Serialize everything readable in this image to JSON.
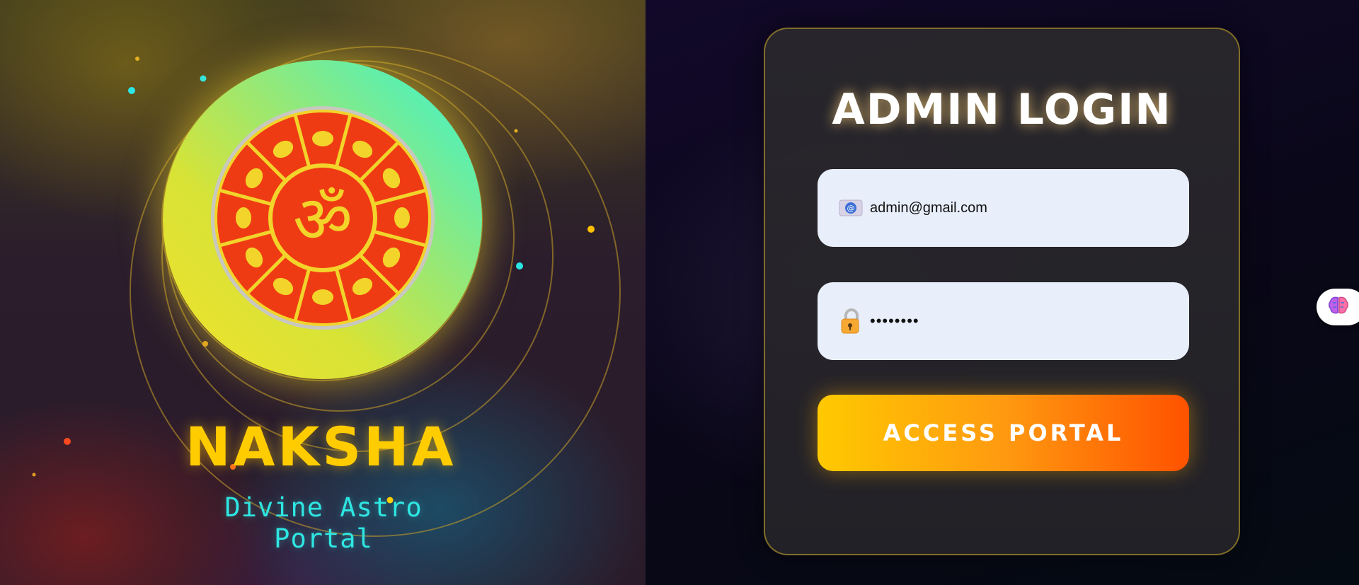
{
  "brand": {
    "name": "NAKSHA",
    "tagline": "Divine Astro Portal",
    "emblem_icon": "om-zodiac-wheel-icon"
  },
  "login": {
    "title": "ADMIN LOGIN",
    "email": {
      "value": "admin@gmail.com",
      "icon": "email-icon"
    },
    "password": {
      "value": "password",
      "icon": "lock-icon"
    },
    "submit_label": "ACCESS PORTAL"
  },
  "side_widget": {
    "icon": "brain-icon"
  },
  "colors": {
    "accent_gold": "#ffcc00",
    "accent_cyan": "#2ee6e2",
    "button_start": "#ffc900",
    "button_end": "#ff5200",
    "wheel_red": "#ef3b14"
  }
}
